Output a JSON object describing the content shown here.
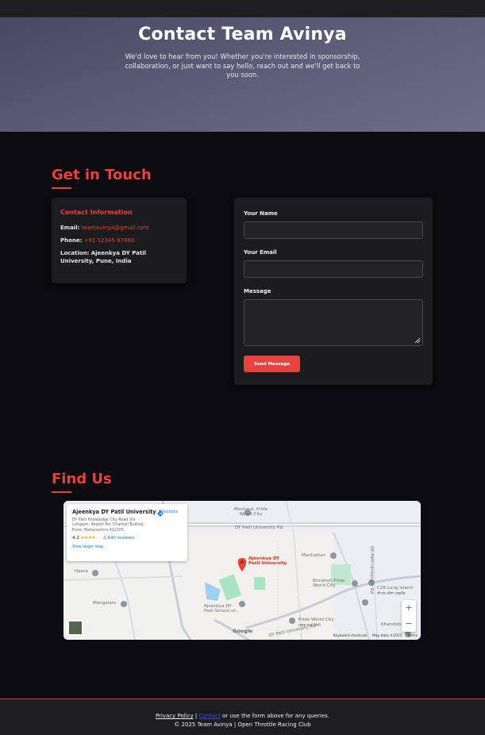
{
  "hero": {
    "title": "Contact Team Avinya",
    "subtitle": "We'd love to hear from you! Whether you're interested in sponsorship, collaboration, or just want to say hello, reach out and we'll get back to you soon."
  },
  "get_in_touch": {
    "title": "Get in Touch",
    "info": {
      "heading": "Contact Information",
      "email_label": "Email:",
      "email": "teamavinya@gmail.com",
      "phone_label": "Phone:",
      "phone": "+91 12345 67890",
      "location_label": "Location:",
      "location": "Ajeenkya DY Patil University, Pune, India"
    },
    "form": {
      "name_label": "Your Name",
      "name_value": "",
      "email_label": "Your Email",
      "email_value": "",
      "message_label": "Message",
      "message_value": "",
      "submit_label": "Send Message"
    }
  },
  "find_us": {
    "title": "Find Us",
    "map": {
      "place_name": "Ajeenkya DY Patil University",
      "place_address": "DY Patil Knowledge City Road Via Lohgaon, Airport Rd, Charholi Budruk, Pune, Maharashtra 412105",
      "rating": "4.2",
      "stars": "★★★★☆",
      "reviews": "2,640 reviews",
      "larger_map": "View larger map",
      "directions": "Directions",
      "pin_label": "Ajeenkya DY Patil University",
      "labels": {
        "montreal": "Montreal, Pride World City",
        "road1": "DY Patil University Rd",
        "manhattan": "Manhattan",
        "brooklyn": "Brooklyn Pride World City",
        "c2k": "C2K Long Island",
        "c2k_sub": "सी२के लॉन्ग आइलैंड",
        "heera": "Heera",
        "mangalam": "Mangalam",
        "school": "Ajeenkya DY Patil School of...",
        "pride": "Pride World City",
        "pride_sub": "प्राइड वर्ल्ड सिटी",
        "khandoba": "Khandoba",
        "road2": "DY Patil University Rd",
        "road3": "DY Patil University Rd",
        "google": "Google",
        "shortcuts": "Keyboard shortcuts",
        "mapdata": "Map data ©2025",
        "terms": "Terms"
      },
      "zoom_in": "+",
      "zoom_out": "−"
    }
  },
  "footer": {
    "privacy": "Privacy Policy",
    "separator1": "|",
    "contact": "Contact",
    "rest": "or use the form above for any queries.",
    "copyright": "© 2025 Team Avinya | Open Throttle Racing Club"
  },
  "colors": {
    "accent": "#e8413f",
    "background": "#0c0c10",
    "card": "#1c1c1e"
  }
}
